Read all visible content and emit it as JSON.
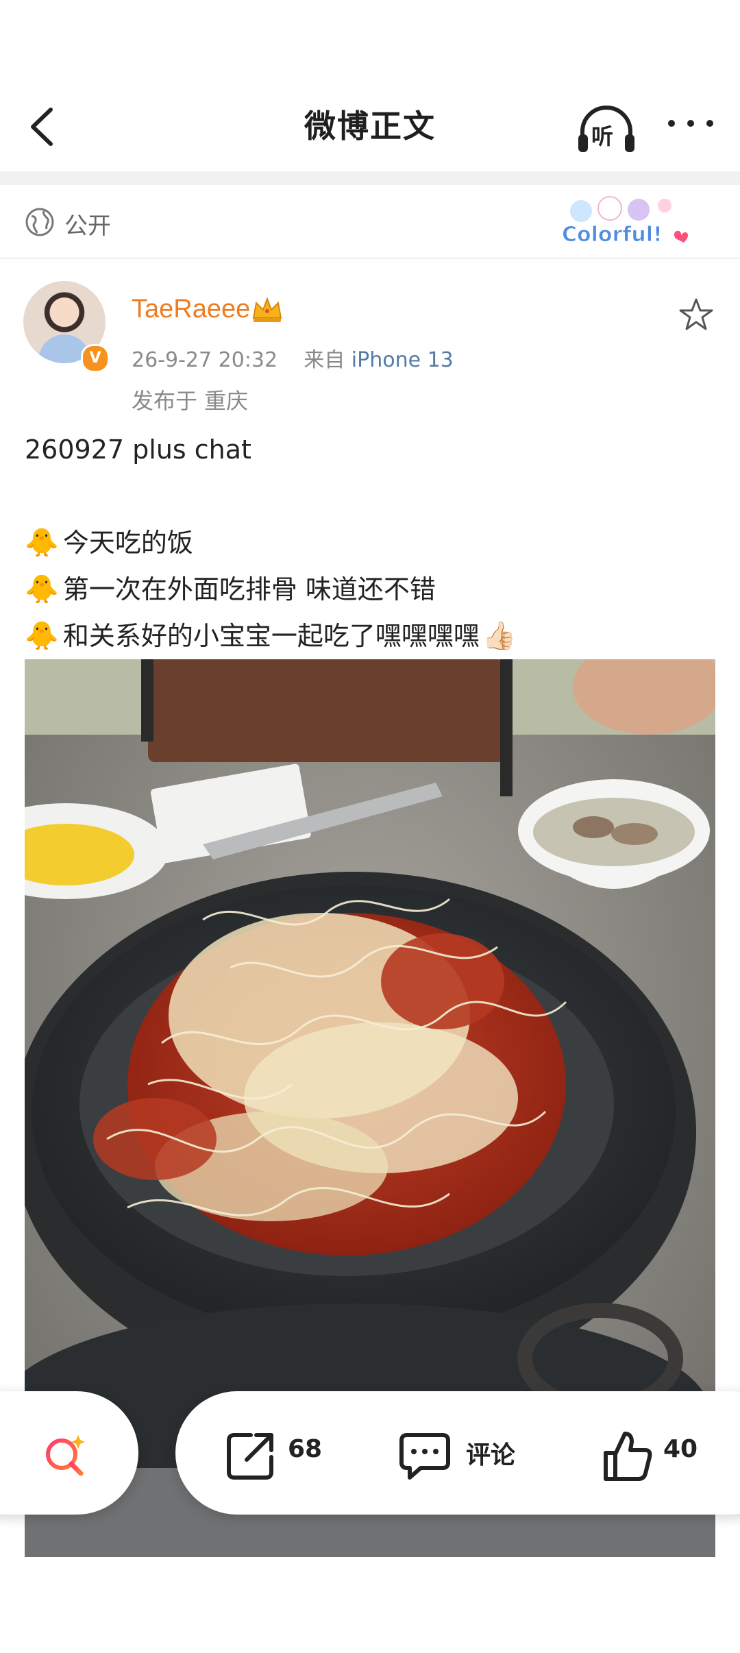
{
  "nav": {
    "title": "微博正文",
    "listen_label": "听"
  },
  "visibility": {
    "label": "公开",
    "badge_text": "Colorful!"
  },
  "author": {
    "name": "TaeRaeee",
    "timestamp": "26-9-27 20:32",
    "source_prefix": "来自",
    "device": "iPhone 13",
    "location": "发布于 重庆"
  },
  "post": {
    "lines": [
      "260927 plus chat",
      "",
      "今天吃的饭",
      "第一次在外面吃排骨 味道还不错",
      "和关系好的小宝宝一起吃了嘿嘿嘿嘿"
    ],
    "emoji_chick": "🐥",
    "emoji_thumb": "👍🏻"
  },
  "actions": {
    "repost_count": "68",
    "comment_label": "评论",
    "like_count": "40"
  },
  "colors": {
    "accent_orange": "#f07b1f",
    "link_blue": "#557aa6",
    "search_gradient_start": "#ff3b6b",
    "search_gradient_end": "#ff7a3a"
  }
}
